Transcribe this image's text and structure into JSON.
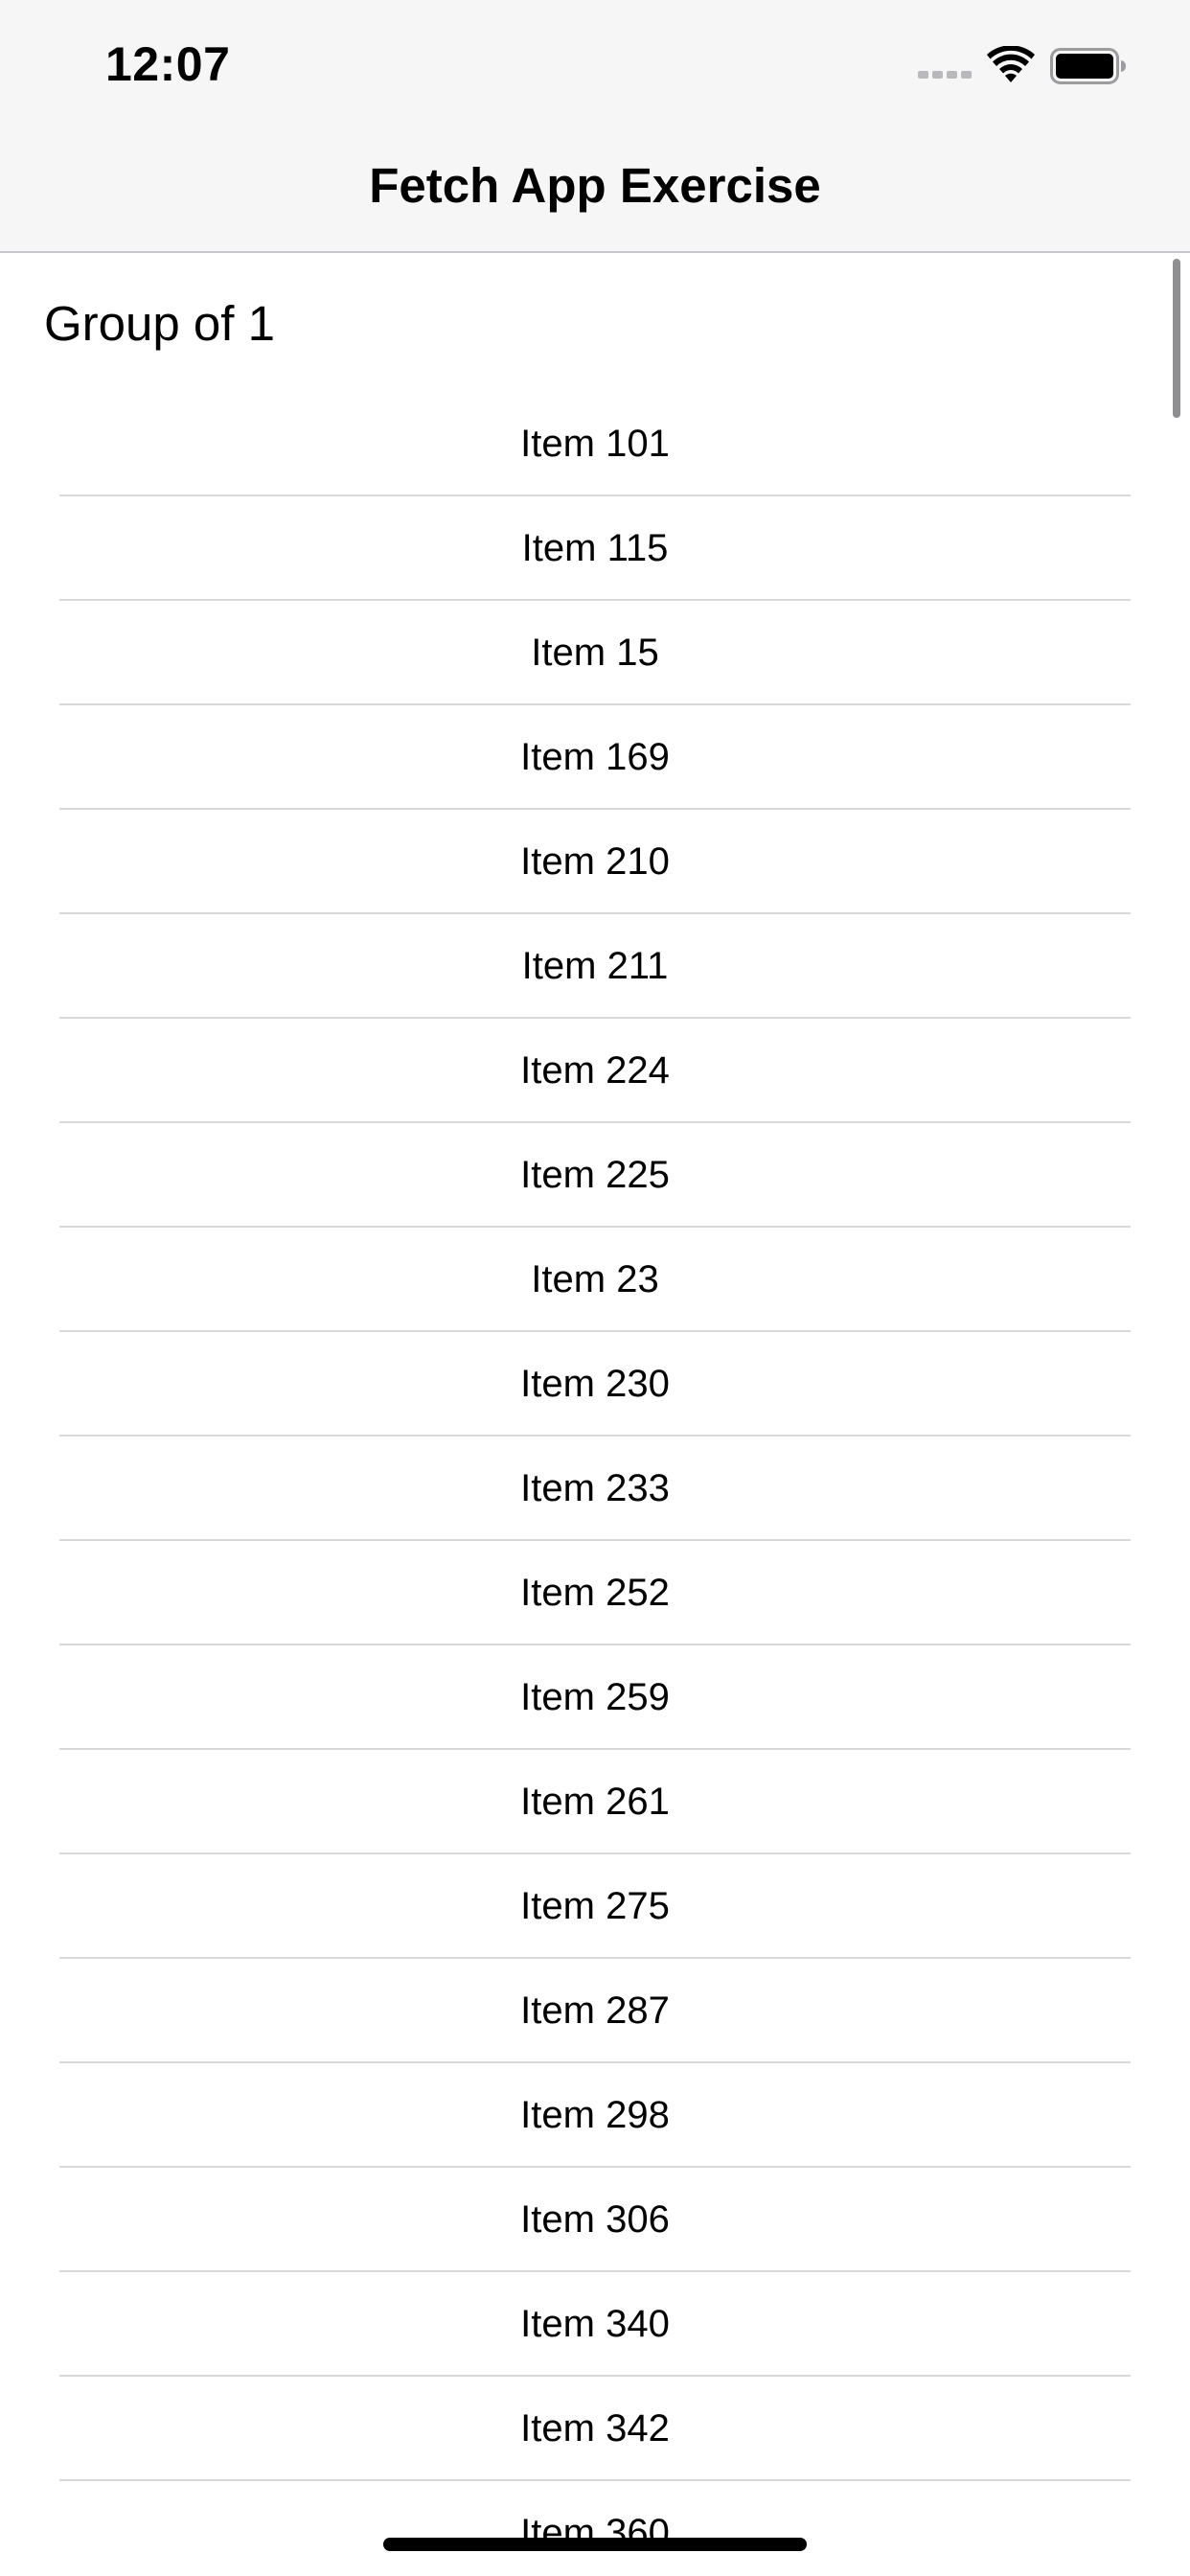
{
  "status_bar": {
    "time": "12:07",
    "icons": [
      "cellular-signal-icon",
      "wifi-icon",
      "battery-icon"
    ]
  },
  "nav": {
    "title": "Fetch App Exercise"
  },
  "list": {
    "section_header": "Group of 1",
    "items": [
      "Item 101",
      "Item 115",
      "Item 15",
      "Item 169",
      "Item 210",
      "Item 211",
      "Item 224",
      "Item 225",
      "Item 23",
      "Item 230",
      "Item 233",
      "Item 252",
      "Item 259",
      "Item 261",
      "Item 275",
      "Item 287",
      "Item 298",
      "Item 306",
      "Item 340",
      "Item 342",
      "Item 360"
    ]
  },
  "colors": {
    "bar_background": "#f6f6f7",
    "separator": "#d9d9dc",
    "text": "#000000"
  }
}
